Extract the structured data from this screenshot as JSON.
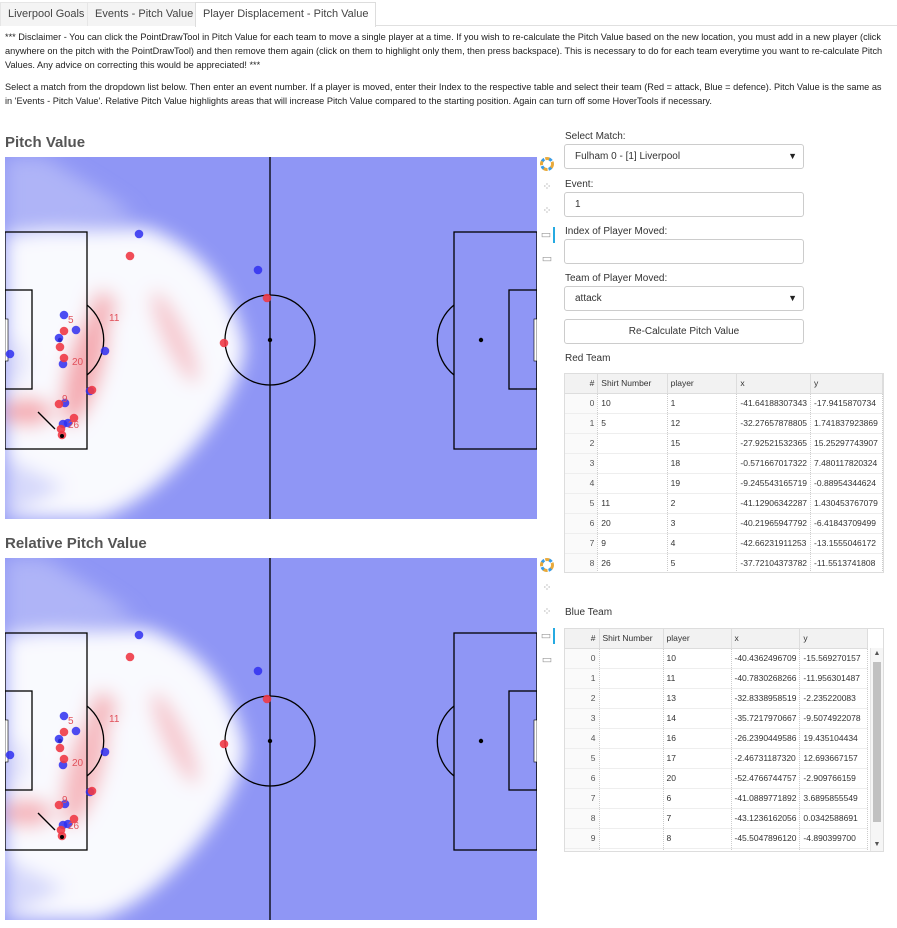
{
  "tabs": [
    {
      "label": "Liverpool Goals"
    },
    {
      "label": "Events - Pitch Value"
    },
    {
      "label": "Player Displacement - Pitch Value"
    }
  ],
  "disclaimer": "*** Disclaimer - You can click the PointDrawTool in Pitch Value for each team to move a single player at a time. If you wish to re-calculate the Pitch Value based on the new location, you must add in a new player (click anywhere on the pitch with the PointDrawTool) and then remove them again (click on them to highlight only them, then press backspace). This is necessary to do for each team everytime you want to re-calculate Pitch Values. Any advice on correcting this would be appreciated! ***",
  "instructions": "Select a match from the dropdown list below. Then enter an event number. If a player is moved, enter their Index to the respective table and select their team (Red = attack, Blue = defence). Pitch Value is the same as in 'Events - Pitch Value'. Relative Pitch Value highlights areas that will increase Pitch Value compared to the starting position. Again can turn off some HoverTools if necessary.",
  "plots": {
    "pitch_value_title": "Pitch Value",
    "relative_title": "Relative Pitch Value",
    "red_labels": [
      "11",
      "5",
      "20",
      "9",
      "26"
    ]
  },
  "controls": {
    "match_label": "Select Match:",
    "match_value": "Fulham 0 - [1] Liverpool",
    "event_label": "Event:",
    "event_value": "1",
    "index_label": "Index of Player Moved:",
    "index_value": "",
    "team_label": "Team of Player Moved:",
    "team_value": "attack",
    "recalc_label": "Re-Calculate Pitch Value"
  },
  "red_team": {
    "label": "Red Team",
    "columns": [
      "#",
      "Shirt Number",
      "player",
      "x",
      "y"
    ],
    "rows": [
      [
        "0",
        "10",
        "1",
        "-41.64188307343",
        "-17.9415870734"
      ],
      [
        "1",
        "5",
        "12",
        "-32.27657878805",
        "1.741837923869"
      ],
      [
        "2",
        "",
        "15",
        "-27.92521532365",
        "15.25297743907"
      ],
      [
        "3",
        "",
        "18",
        "-0.571667017322",
        "7.480117820324"
      ],
      [
        "4",
        "",
        "19",
        "-9.245543165719",
        "-0.88954344624"
      ],
      [
        "5",
        "11",
        "2",
        "-41.12906342287",
        "1.430453767079"
      ],
      [
        "6",
        "20",
        "3",
        "-40.21965947792",
        "-6.41843709499"
      ],
      [
        "7",
        "9",
        "4",
        "-42.66231911253",
        "-13.1555046172"
      ],
      [
        "8",
        "26",
        "5",
        "-37.72104373782",
        "-11.5513741808"
      ]
    ]
  },
  "blue_team": {
    "label": "Blue Team",
    "columns": [
      "#",
      "Shirt Number",
      "player",
      "x",
      "y"
    ],
    "rows": [
      [
        "0",
        "",
        "10",
        "-40.4362496709",
        "-15.569270157"
      ],
      [
        "1",
        "",
        "11",
        "-40.7830268266",
        "-11.956301487"
      ],
      [
        "2",
        "",
        "13",
        "-32.8338958519",
        "-2.235220083"
      ],
      [
        "3",
        "",
        "14",
        "-35.7217970667",
        "-9.5074922078"
      ],
      [
        "4",
        "",
        "16",
        "-26.2390449586",
        "19.435104434"
      ],
      [
        "5",
        "",
        "17",
        "-2.46731187320",
        "12.693667157"
      ],
      [
        "6",
        "",
        "20",
        "-52.4766744757",
        "-2.909766159"
      ],
      [
        "7",
        "",
        "6",
        "-41.0889771892",
        "3.6895855549"
      ],
      [
        "8",
        "",
        "7",
        "-43.1236162056",
        "0.0342588691"
      ],
      [
        "9",
        "",
        "8",
        "-45.5047896120",
        "-4.890399700"
      ],
      [
        "",
        "",
        "",
        "",
        ""
      ]
    ]
  },
  "colors": {
    "pitch_blue": "#8f96f5",
    "attack": "#ee3a46",
    "defence": "#2f2ff0"
  }
}
